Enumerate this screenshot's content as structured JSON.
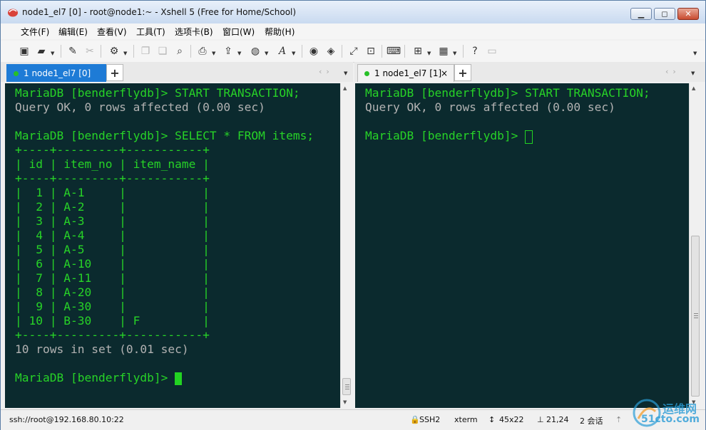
{
  "window": {
    "title": "node1_el7 [0] - root@node1:~ - Xshell 5 (Free for Home/School)",
    "minimize": "▁",
    "maximize": "◻",
    "close": "✕"
  },
  "menu": [
    "文件(F)",
    "编辑(E)",
    "查看(V)",
    "工具(T)",
    "选项卡(B)",
    "窗口(W)",
    "帮助(H)"
  ],
  "tabs_left": {
    "label": "1 node1_el7 [0]",
    "close": "×",
    "add": "+"
  },
  "tabs_right": {
    "label": "1 node1_el7 [1]",
    "close": "×",
    "add": "+"
  },
  "terminal_left": {
    "lines": [
      {
        "text": "MariaDB [benderflydb]> START TRANSACTION;",
        "color": "#27d327"
      },
      {
        "text": "Query OK, 0 rows affected (0.00 sec)",
        "color": "#b2b2b2"
      },
      {
        "text": "",
        "color": "#27d327"
      },
      {
        "text": "MariaDB [benderflydb]> SELECT * FROM items;",
        "color": "#27d327"
      },
      {
        "text": "+----+---------+-----------+",
        "color": "#27d327"
      },
      {
        "text": "| id | item_no | item_name |",
        "color": "#27d327"
      },
      {
        "text": "+----+---------+-----------+",
        "color": "#27d327"
      },
      {
        "text": "|  1 | A-1     |           |",
        "color": "#27d327"
      },
      {
        "text": "|  2 | A-2     |           |",
        "color": "#27d327"
      },
      {
        "text": "|  3 | A-3     |           |",
        "color": "#27d327"
      },
      {
        "text": "|  4 | A-4     |           |",
        "color": "#27d327"
      },
      {
        "text": "|  5 | A-5     |           |",
        "color": "#27d327"
      },
      {
        "text": "|  6 | A-10    |           |",
        "color": "#27d327"
      },
      {
        "text": "|  7 | A-11    |           |",
        "color": "#27d327"
      },
      {
        "text": "|  8 | A-20    |           |",
        "color": "#27d327"
      },
      {
        "text": "|  9 | A-30    |           |",
        "color": "#27d327"
      },
      {
        "text": "| 10 | B-30    | F         |",
        "color": "#27d327"
      },
      {
        "text": "+----+---------+-----------+",
        "color": "#27d327"
      },
      {
        "text": "10 rows in set (0.01 sec)",
        "color": "#b2b2b2"
      },
      {
        "text": "",
        "color": "#27d327"
      },
      {
        "text": "MariaDB [benderflydb]> ",
        "color": "#27d327"
      }
    ]
  },
  "terminal_right": {
    "lines": [
      {
        "text": "MariaDB [benderflydb]> START TRANSACTION;",
        "color": "#27d327"
      },
      {
        "text": "Query OK, 0 rows affected (0.00 sec)",
        "color": "#b2b2b2"
      },
      {
        "text": "",
        "color": "#27d327"
      },
      {
        "text": "MariaDB [benderflydb]> ",
        "color": "#27d327"
      }
    ]
  },
  "status": {
    "connection": "ssh://root@192.168.80.10:22",
    "protocol": "SSH2",
    "term": "xterm",
    "size": "45x22",
    "position": "21,24",
    "sessions": "2 会话"
  },
  "watermark": {
    "site": "运维网",
    "domain": "51cto.com"
  },
  "colors": {
    "terminal_bg": "#0b2a2e",
    "prompt_green": "#27d327",
    "output_gray": "#b2b2b2",
    "active_tab": "#1e7bd6"
  }
}
